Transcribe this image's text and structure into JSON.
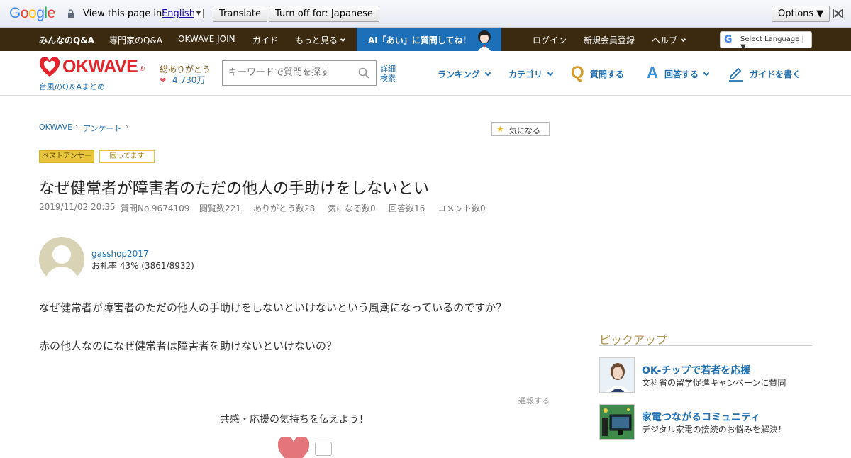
{
  "translate_bar": {
    "logo": "Google",
    "prompt": "View this page in:",
    "language": "English",
    "translate_button": "Translate",
    "turn_off_button": "Turn off for: Japanese",
    "options_button": "Options ▼"
  },
  "top_nav": {
    "items": [
      "みんなのQ&A",
      "専門家のQ&A",
      "OKWAVE JOIN",
      "ガイド",
      "もっと見る"
    ],
    "ai_banner": "AI「あい」に質問してね！",
    "right_items": [
      "ログイン",
      "新規会員登録",
      "ヘルプ"
    ],
    "select_language": "Select Language | ▼"
  },
  "header": {
    "logo": "OKWAVE",
    "logo_mark": "®",
    "tagline": "台風のQ＆Aまとめ",
    "thanks_label": "総ありがとう",
    "thanks_count": "4,730万",
    "search_placeholder": "キーワードで質問を探す",
    "advanced_search": "詳細検索",
    "nav": {
      "ranking": "ランキング",
      "category": "カテゴリ",
      "ask": "質問する",
      "answer": "回答する",
      "write_guide": "ガイドを書く"
    }
  },
  "breadcrumb": [
    "OKWAVE",
    "アンケート"
  ],
  "watch_button": "気になる",
  "badges": {
    "best_answer": "ベストアンサー",
    "status": "困ってます"
  },
  "question": {
    "title": "なぜ健常者が障害者のただの他人の手助けをしないとい",
    "meta": {
      "date": "2019/11/02 20:35",
      "number": "質問No.9674109",
      "views": "閲覧数221",
      "thanks": "ありがとう数28",
      "watch": "気になる数0",
      "answers": "回答数16",
      "comments": "コメント数0"
    },
    "user": {
      "name": "gasshop2017",
      "rate": "お礼率 43%  (3861/8932)"
    },
    "body": [
      "なぜ健常者が障害者のただの他人の手助けをしないといけないという風潮になっているのですか？",
      "赤の他人なのになぜ健常者は障害者を助けないといけないの？"
    ],
    "report": "通報する",
    "cheer": "共感・応援の気持ちを伝えよう！"
  },
  "sidebar": {
    "pickup_title": "ピックアップ",
    "items": [
      {
        "title": "OK-チップで若者を応援",
        "desc": "文科省の留学促進キャンペーンに賛同"
      },
      {
        "title": "家電つながるコミュニティ",
        "desc": "デジタル家電の接続のお悩みを解決！"
      }
    ]
  },
  "colors": {
    "brand_red": "#e3262e",
    "link_blue": "#1f6fb2",
    "nav_brown": "#3b2a10",
    "ai_blue": "#1d6fb8"
  }
}
